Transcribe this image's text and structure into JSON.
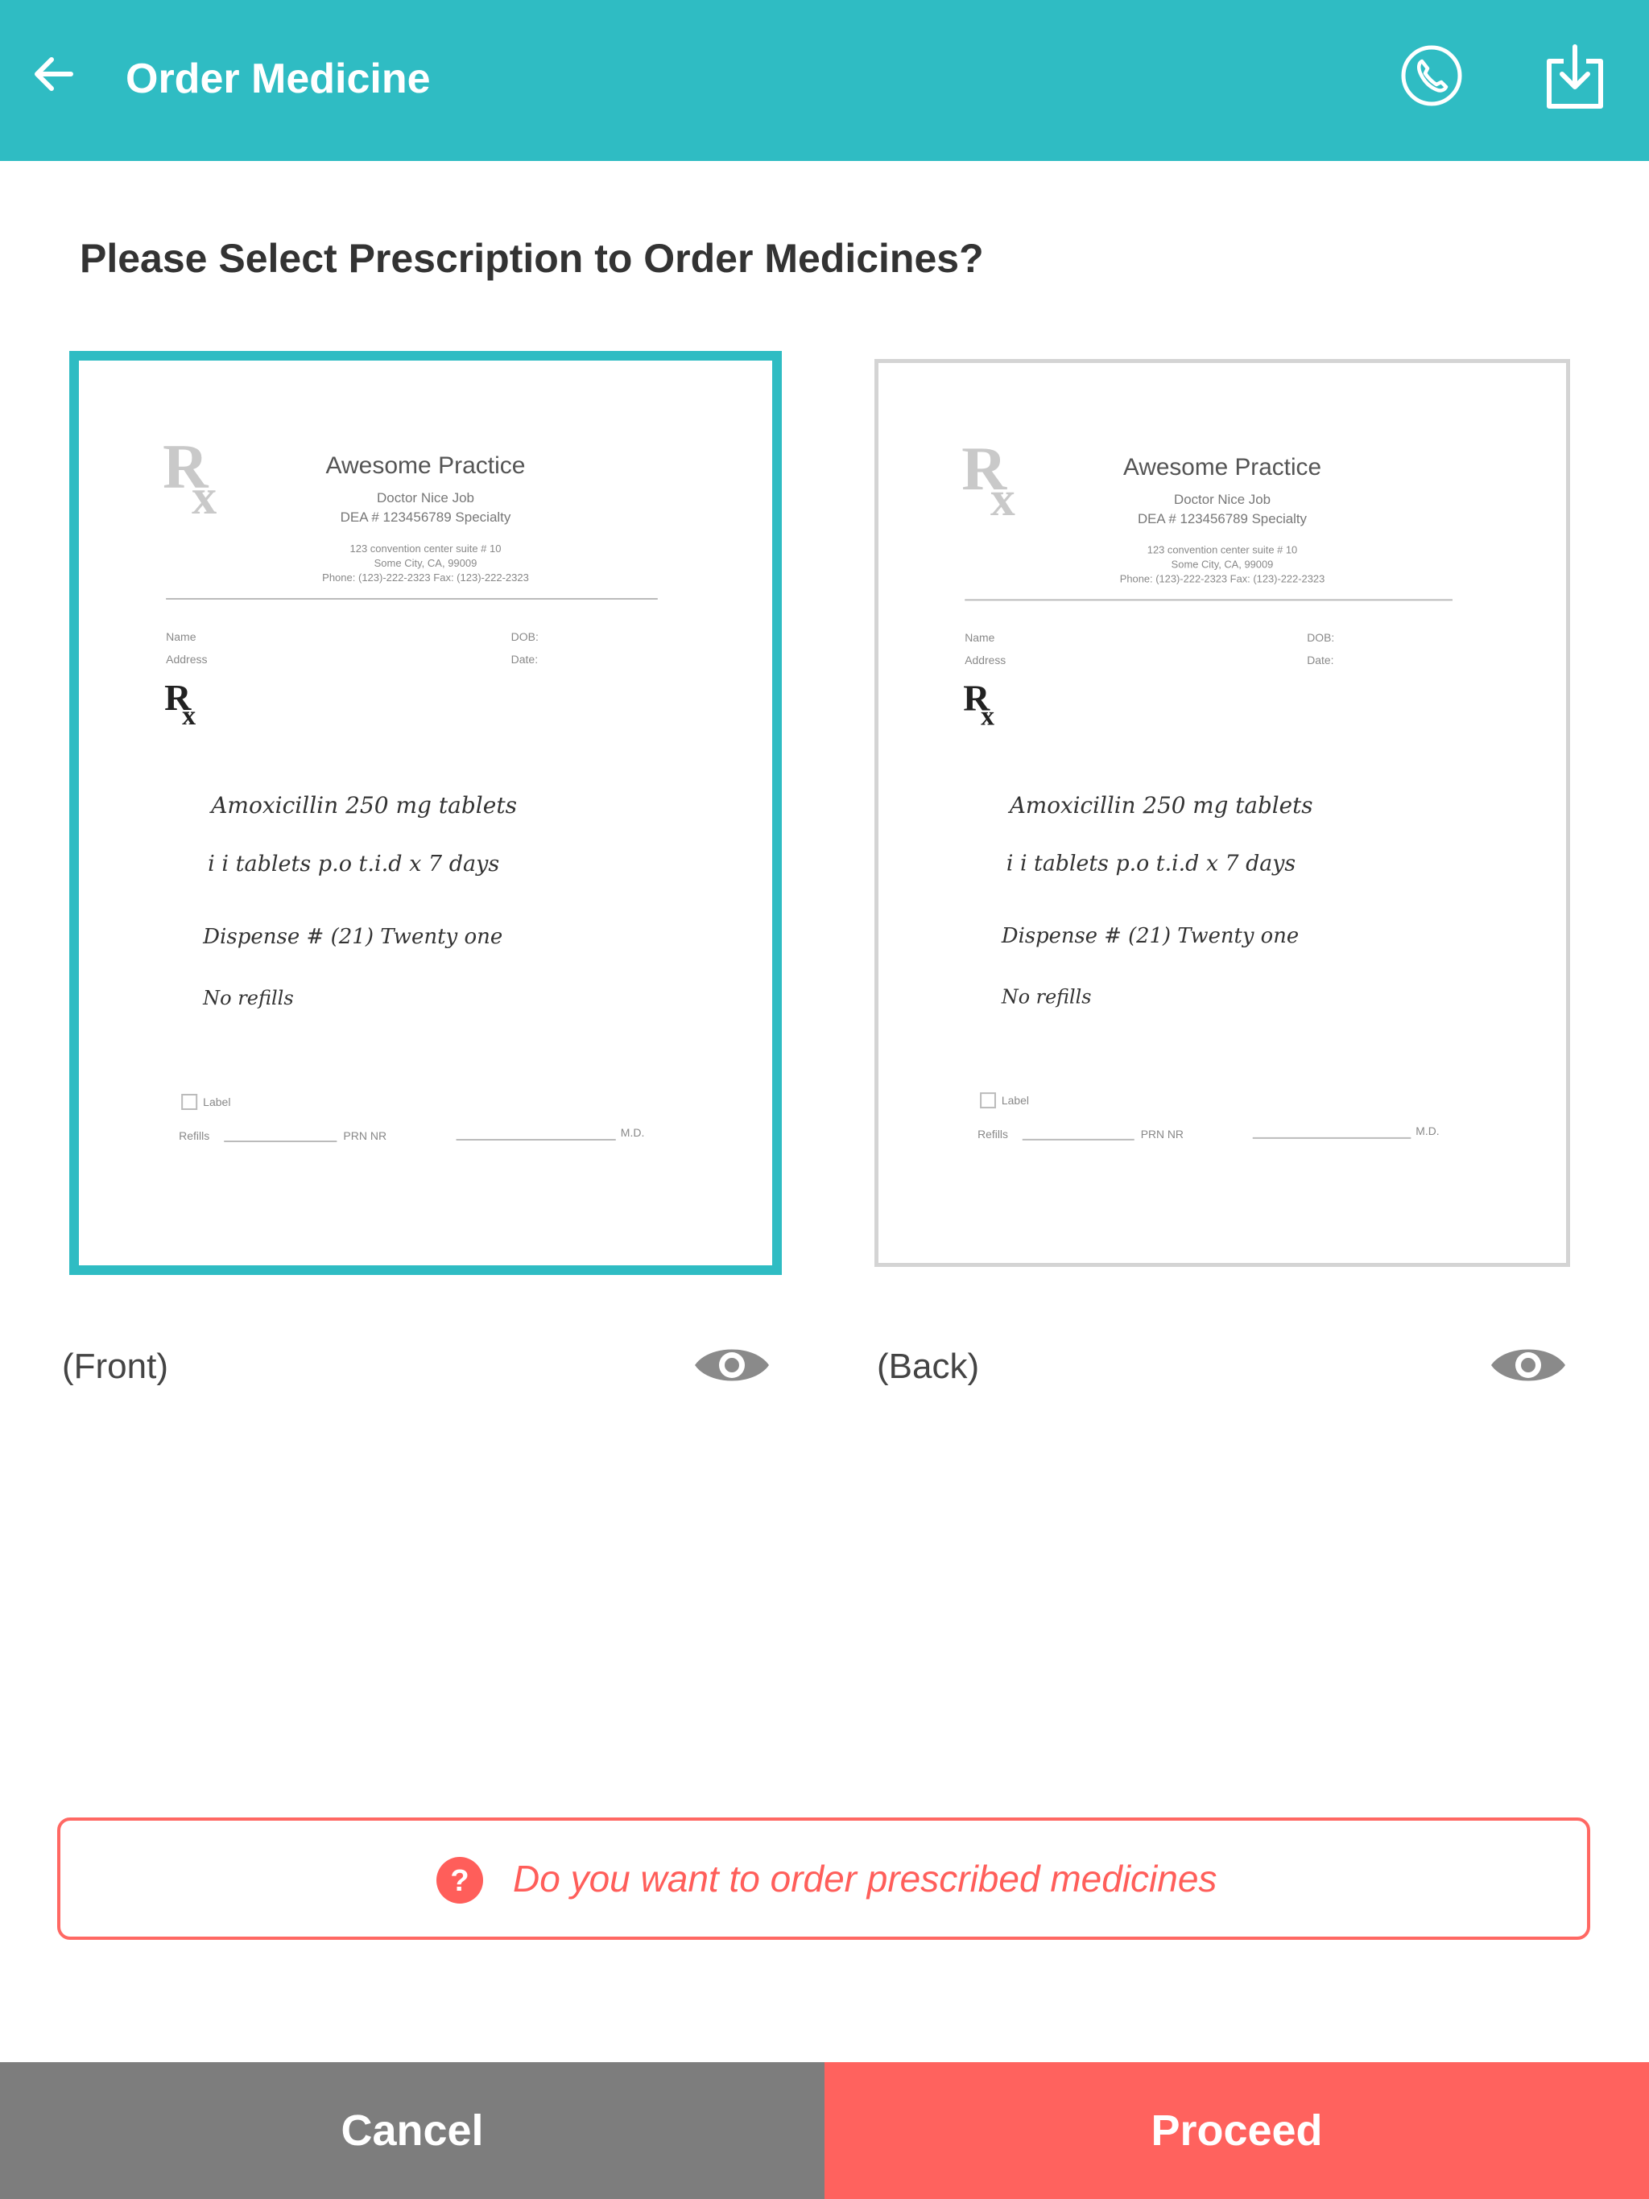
{
  "header": {
    "title": "Order Medicine",
    "back_icon": "arrow-left-icon",
    "call_icon": "phone-icon",
    "download_icon": "download-icon",
    "color": "#2fbcc3"
  },
  "prompt": "Please Select Prescription to Order Medicines?",
  "prescription": {
    "practice": "Awesome Practice",
    "doctor": "Doctor Nice Job",
    "dea": "DEA # 123456789 Specialty",
    "address1": "123 convention center suite # 10",
    "address2": "Some City, CA, 99009",
    "phone": "Phone: (123)-222-2323  Fax: (123)-222-2323",
    "name_label": "Name",
    "address_label": "Address",
    "dob_label": "DOB:",
    "date_label": "Date:",
    "rx": "Rx",
    "line1": "Amoxicillin  250 mg tablets",
    "line2": "i i  tablets  p.o  t.i.d  x 7 days",
    "line3": "Dispense #  (21)  Twenty one",
    "line4": "No  refills",
    "label_checkbox": "Label",
    "refills_label": "Refills",
    "prn_nr": "PRN   NR",
    "md": "M.D."
  },
  "cards": [
    {
      "side_label": "(Front)",
      "selected": true
    },
    {
      "side_label": "(Back)",
      "selected": false
    }
  ],
  "question": {
    "icon": "help-circle-icon",
    "text": "Do you want to order prescribed medicines",
    "color": "#ff5e5a"
  },
  "actions": {
    "cancel": "Cancel",
    "proceed": "Proceed"
  }
}
